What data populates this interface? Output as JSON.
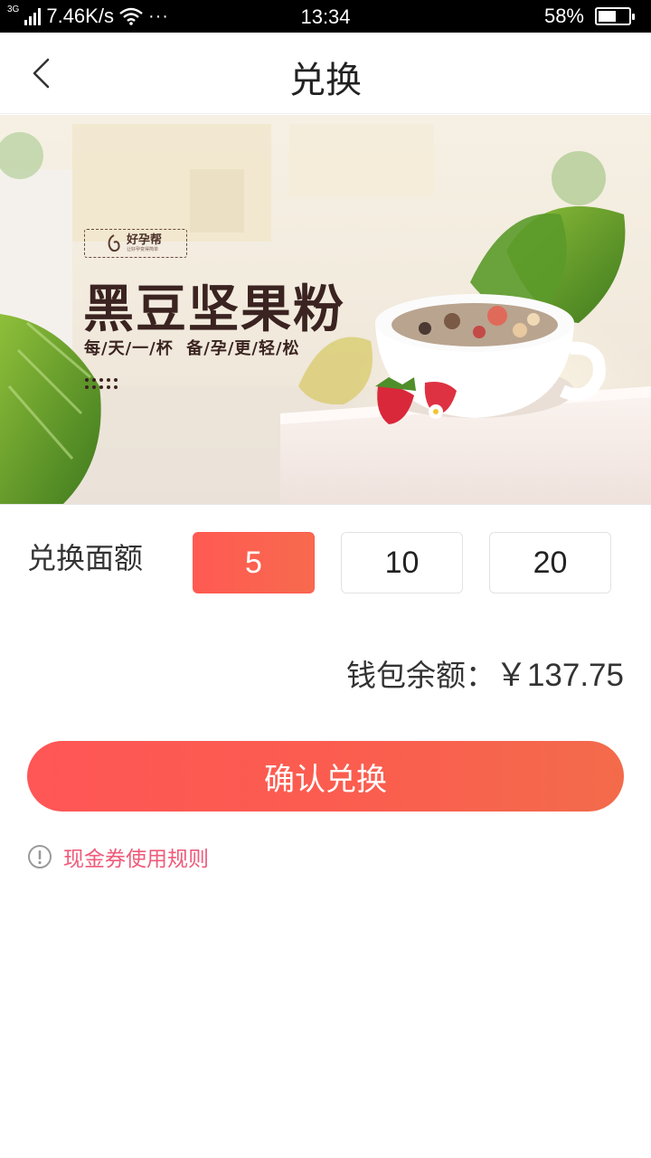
{
  "status_bar": {
    "network": "3G",
    "speed": "7.46K/s",
    "more": "···",
    "time": "13:34",
    "battery_pct": "58%",
    "battery_level": 0.58
  },
  "nav": {
    "title": "兑换",
    "back_icon": "chevron-left-icon"
  },
  "banner": {
    "brand": "好孕帮",
    "brand_tagline": "让好孕变得简单",
    "headline": "黑豆坚果粉",
    "slogan": "每/天/一/杯  备/孕/更/轻/松"
  },
  "exchange": {
    "amount_label": "兑换面额",
    "options": [
      "5",
      "10",
      "20"
    ],
    "selected": "5",
    "accent_color": "#ff5a52"
  },
  "wallet": {
    "label": "钱包余额：",
    "amount": "￥137.75"
  },
  "confirm_button": "确认兑换",
  "rules_link": {
    "text": "现金券使用规则",
    "icon": "info-circle-icon",
    "color": "#ef5a7a"
  }
}
